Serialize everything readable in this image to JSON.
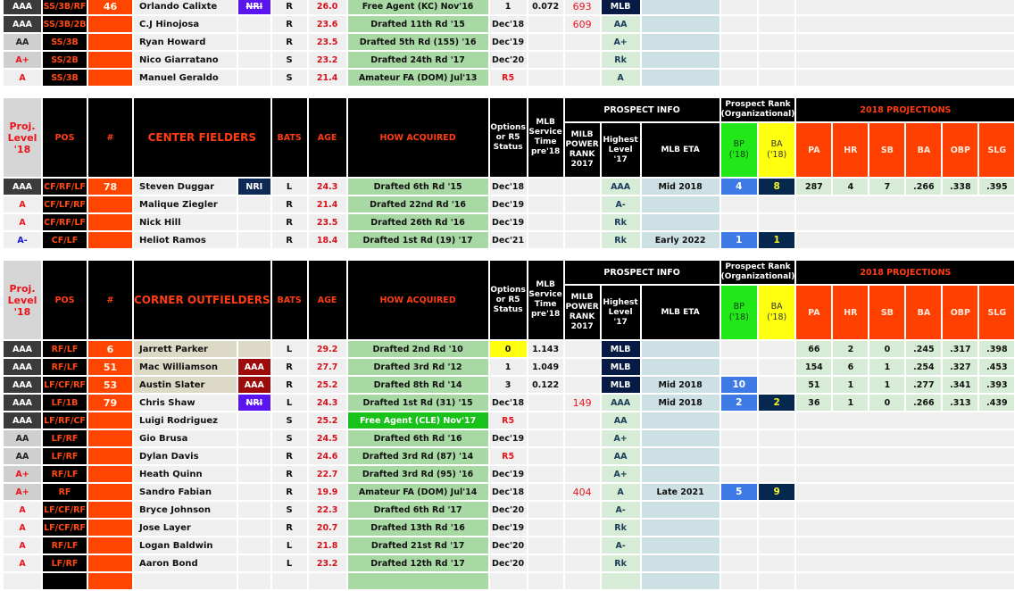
{
  "headers": {
    "proj_level": "Proj. Level '18",
    "pos": "POS",
    "num": "#",
    "bats": "BATS",
    "age": "AGE",
    "how_acquired": "HOW ACQUIRED",
    "options": "Options or R5 Status",
    "service_time": "MLB Service Time pre'18",
    "prospect_info": "PROSPECT INFO",
    "power_rank": "MILB POWER RANK 2017",
    "highest_level": "Highest Level '17",
    "mlb_eta": "MLB ETA",
    "prospect_rank": "Prospect Rank (Organizational)",
    "bp": "BP ('18)",
    "ba": "BA ('18)",
    "projections": "2018 PROJECTIONS",
    "proj_cols": [
      "PA",
      "HR",
      "SB",
      "BA",
      "OBP",
      "SLG"
    ]
  },
  "sections": [
    {
      "title": "",
      "rows": [
        {
          "level": "AAA",
          "level_style": "dark",
          "pos": "SS/3B/RF",
          "num": "46",
          "name": "Orlando Calixte",
          "badge": "NRI",
          "badge_style": "nri-purple",
          "bats": "R",
          "age": "26.0",
          "how": "Free Agent (KC) Nov'16",
          "how_style": "",
          "opt": "1",
          "opt_style": "",
          "svc": "0.072",
          "pwr": "693",
          "hi": "MLB",
          "eta": "",
          "bp": "",
          "ba": "",
          "proj": null
        },
        {
          "level": "AAA",
          "level_style": "dark",
          "pos": "SS/3B/2B",
          "num": "",
          "name": "C.J Hinojosa",
          "badge": "",
          "badge_style": "",
          "bats": "R",
          "age": "23.6",
          "how": "Drafted 11th Rd '15",
          "how_style": "",
          "opt": "Dec'18",
          "opt_style": "",
          "svc": "",
          "pwr": "609",
          "hi": "AA",
          "eta": "",
          "bp": "",
          "ba": "",
          "proj": null
        },
        {
          "level": "AA",
          "level_style": "light",
          "pos": "SS/3B",
          "num": "",
          "name": "Ryan Howard",
          "badge": "",
          "badge_style": "",
          "bats": "R",
          "age": "23.5",
          "how": "Drafted 5th Rd (155) '16",
          "how_style": "",
          "opt": "Dec'19",
          "opt_style": "",
          "svc": "",
          "pwr": "",
          "hi": "A+",
          "eta": "",
          "bp": "",
          "ba": "",
          "proj": null
        },
        {
          "level": "A+",
          "level_style": "red-light",
          "pos": "SS/2B",
          "num": "",
          "name": "Nico Giarratano",
          "badge": "",
          "badge_style": "",
          "bats": "S",
          "age": "23.2",
          "how": "Drafted 24th Rd '17",
          "how_style": "",
          "opt": "Dec'20",
          "opt_style": "",
          "svc": "",
          "pwr": "",
          "hi": "Rk",
          "eta": "",
          "bp": "",
          "ba": "",
          "proj": null
        },
        {
          "level": "A",
          "level_style": "pale",
          "pos": "SS/3B",
          "num": "",
          "name": "Manuel Geraldo",
          "badge": "",
          "badge_style": "",
          "bats": "S",
          "age": "21.4",
          "how": "Amateur FA (DOM) Jul'13",
          "how_style": "",
          "opt": "R5",
          "opt_style": "r5",
          "svc": "",
          "pwr": "",
          "hi": "A",
          "eta": "",
          "bp": "",
          "ba": "",
          "proj": null
        }
      ]
    },
    {
      "title": "CENTER FIELDERS",
      "rows": [
        {
          "level": "AAA",
          "level_style": "dark",
          "pos": "CF/RF/LF",
          "num": "78",
          "name": "Steven Duggar",
          "badge": "NRI",
          "badge_style": "nri-navy",
          "bats": "L",
          "age": "24.3",
          "how": "Drafted 6th Rd '15",
          "how_style": "",
          "opt": "Dec'18",
          "opt_style": "",
          "svc": "",
          "pwr": "",
          "hi": "AAA",
          "eta": "Mid 2018",
          "bp": "4",
          "ba": "8",
          "proj": [
            "287",
            "4",
            "7",
            ".266",
            ".338",
            ".395"
          ]
        },
        {
          "level": "A",
          "level_style": "pale",
          "pos": "CF/LF/RF",
          "num": "",
          "name": "Malique Ziegler",
          "badge": "",
          "badge_style": "",
          "bats": "R",
          "age": "21.4",
          "how": "Drafted 22nd Rd '16",
          "how_style": "",
          "opt": "Dec'19",
          "opt_style": "",
          "svc": "",
          "pwr": "",
          "hi": "A-",
          "eta": "",
          "bp": "",
          "ba": "",
          "proj": null
        },
        {
          "level": "A",
          "level_style": "pale",
          "pos": "CF/RF/LF",
          "num": "",
          "name": "Nick Hill",
          "badge": "",
          "badge_style": "",
          "bats": "R",
          "age": "23.5",
          "how": "Drafted 26th Rd '16",
          "how_style": "",
          "opt": "Dec'19",
          "opt_style": "",
          "svc": "",
          "pwr": "",
          "hi": "Rk",
          "eta": "",
          "bp": "",
          "ba": "",
          "proj": null
        },
        {
          "level": "A-",
          "level_style": "blue",
          "pos": "CF/LF",
          "num": "",
          "name": "Heliot Ramos",
          "badge": "",
          "badge_style": "",
          "bats": "R",
          "age": "18.4",
          "how": "Drafted 1st Rd (19) '17",
          "how_style": "",
          "opt": "Dec'21",
          "opt_style": "",
          "svc": "",
          "pwr": "",
          "hi": "Rk",
          "eta": "Early 2022",
          "bp": "1",
          "ba": "1",
          "proj": null
        }
      ]
    },
    {
      "title": "CORNER OUTFIELDERS",
      "rows": [
        {
          "level": "AAA",
          "level_style": "dark",
          "pos": "RF/LF",
          "num": "6",
          "name": "Jarrett Parker",
          "name_style": "tan",
          "badge": "",
          "badge_style": "tan",
          "bats": "L",
          "age": "29.2",
          "how": "Drafted 2nd Rd '10",
          "how_style": "",
          "opt": "0",
          "opt_style": "yellow",
          "svc": "1.143",
          "pwr": "",
          "hi": "MLB",
          "eta": "",
          "bp": "",
          "ba": "",
          "proj": [
            "66",
            "2",
            "0",
            ".245",
            ".317",
            ".398"
          ]
        },
        {
          "level": "AAA",
          "level_style": "dark",
          "pos": "RF/LF",
          "num": "51",
          "name": "Mac Williamson",
          "name_style": "tan",
          "badge": "AAA",
          "badge_style": "aaa-red",
          "bats": "R",
          "age": "27.7",
          "how": "Drafted 3rd Rd '12",
          "how_style": "",
          "opt": "1",
          "opt_style": "",
          "svc": "1.049",
          "pwr": "",
          "hi": "MLB",
          "eta": "",
          "bp": "",
          "ba": "",
          "proj": [
            "154",
            "6",
            "1",
            ".254",
            ".327",
            ".453"
          ]
        },
        {
          "level": "AAA",
          "level_style": "dark",
          "pos": "LF/CF/RF",
          "num": "53",
          "name": "Austin Slater",
          "name_style": "tan",
          "badge": "AAA",
          "badge_style": "aaa-red",
          "bats": "R",
          "age": "25.2",
          "how": "Drafted 8th Rd '14",
          "how_style": "",
          "opt": "3",
          "opt_style": "",
          "svc": "0.122",
          "pwr": "",
          "hi": "MLB",
          "eta": "Mid 2018",
          "bp": "10",
          "ba": "",
          "proj": [
            "51",
            "1",
            "1",
            ".277",
            ".341",
            ".393"
          ]
        },
        {
          "level": "AAA",
          "level_style": "dark",
          "pos": "LF/1B",
          "num": "79",
          "name": "Chris Shaw",
          "badge": "NRI",
          "badge_style": "nri-purple",
          "bats": "L",
          "age": "24.3",
          "how": "Drafted 1st Rd (31) '15",
          "how_style": "",
          "opt": "Dec'18",
          "opt_style": "",
          "svc": "",
          "pwr": "149",
          "hi": "AAA",
          "eta": "Mid 2018",
          "bp": "2",
          "ba": "2",
          "proj": [
            "36",
            "1",
            "0",
            ".266",
            ".313",
            ".439"
          ]
        },
        {
          "level": "AAA",
          "level_style": "dark",
          "pos": "LF/RF/CF",
          "num": "",
          "name": "Luigi Rodriguez",
          "badge": "",
          "badge_style": "",
          "bats": "S",
          "age": "25.2",
          "how": "Free Agent (CLE) Nov'17",
          "how_style": "fa-green",
          "opt": "R5",
          "opt_style": "r5",
          "svc": "",
          "pwr": "",
          "hi": "AA",
          "eta": "",
          "bp": "",
          "ba": "",
          "proj": null
        },
        {
          "level": "AA",
          "level_style": "light",
          "pos": "LF/RF",
          "num": "",
          "name": "Gio Brusa",
          "badge": "",
          "badge_style": "",
          "bats": "S",
          "age": "24.5",
          "how": "Drafted 6th Rd '16",
          "how_style": "",
          "opt": "Dec'19",
          "opt_style": "",
          "svc": "",
          "pwr": "",
          "hi": "A+",
          "eta": "",
          "bp": "",
          "ba": "",
          "proj": null
        },
        {
          "level": "AA",
          "level_style": "light",
          "pos": "LF/RF",
          "num": "",
          "name": "Dylan Davis",
          "badge": "",
          "badge_style": "",
          "bats": "R",
          "age": "24.6",
          "how": "Drafted 3rd Rd (87) '14",
          "how_style": "",
          "opt": "R5",
          "opt_style": "r5",
          "svc": "",
          "pwr": "",
          "hi": "AA",
          "eta": "",
          "bp": "",
          "ba": "",
          "proj": null
        },
        {
          "level": "A+",
          "level_style": "red-light",
          "pos": "RF/LF",
          "num": "",
          "name": "Heath Quinn",
          "badge": "",
          "badge_style": "",
          "bats": "R",
          "age": "22.7",
          "how": "Drafted 3rd Rd (95) '16",
          "how_style": "",
          "opt": "Dec'19",
          "opt_style": "",
          "svc": "",
          "pwr": "",
          "hi": "A+",
          "eta": "",
          "bp": "",
          "ba": "",
          "proj": null
        },
        {
          "level": "A+",
          "level_style": "red-light",
          "pos": "RF",
          "num": "",
          "name": "Sandro Fabian",
          "badge": "",
          "badge_style": "",
          "bats": "R",
          "age": "19.9",
          "how": "Amateur FA (DOM) Jul'14",
          "how_style": "",
          "opt": "Dec'18",
          "opt_style": "",
          "svc": "",
          "pwr": "404",
          "hi": "A",
          "eta": "Late 2021",
          "bp": "5",
          "ba": "9",
          "proj": null
        },
        {
          "level": "A",
          "level_style": "pale",
          "pos": "LF/CF/RF",
          "num": "",
          "name": "Bryce Johnson",
          "badge": "",
          "badge_style": "",
          "bats": "S",
          "age": "22.3",
          "how": "Drafted 6th Rd '17",
          "how_style": "",
          "opt": "Dec'20",
          "opt_style": "",
          "svc": "",
          "pwr": "",
          "hi": "A-",
          "eta": "",
          "bp": "",
          "ba": "",
          "proj": null
        },
        {
          "level": "A",
          "level_style": "pale",
          "pos": "LF/CF/RF",
          "num": "",
          "name": "Jose Layer",
          "badge": "",
          "badge_style": "",
          "bats": "R",
          "age": "20.7",
          "how": "Drafted 13th Rd '16",
          "how_style": "",
          "opt": "Dec'19",
          "opt_style": "",
          "svc": "",
          "pwr": "",
          "hi": "Rk",
          "eta": "",
          "bp": "",
          "ba": "",
          "proj": null
        },
        {
          "level": "A",
          "level_style": "pale",
          "pos": "RF/LF",
          "num": "",
          "name": "Logan Baldwin",
          "badge": "",
          "badge_style": "",
          "bats": "L",
          "age": "21.8",
          "how": "Drafted 21st Rd '17",
          "how_style": "",
          "opt": "Dec'20",
          "opt_style": "",
          "svc": "",
          "pwr": "",
          "hi": "A-",
          "eta": "",
          "bp": "",
          "ba": "",
          "proj": null
        },
        {
          "level": "A",
          "level_style": "pale",
          "pos": "LF/RF",
          "num": "",
          "name": "Aaron Bond",
          "badge": "",
          "badge_style": "",
          "bats": "L",
          "age": "23.2",
          "how": "Drafted 12th Rd '17",
          "how_style": "",
          "opt": "Dec'20",
          "opt_style": "",
          "svc": "",
          "pwr": "",
          "hi": "Rk",
          "eta": "",
          "bp": "",
          "ba": "",
          "proj": null
        },
        {
          "level": "",
          "level_style": "pale",
          "pos": "",
          "num": "",
          "name": "",
          "badge": "",
          "badge_style": "",
          "bats": "",
          "age": "",
          "how": "",
          "how_style": "",
          "opt": "",
          "opt_style": "",
          "svc": "",
          "pwr": "",
          "hi": "",
          "eta": "",
          "bp": "",
          "ba": "",
          "proj": null
        }
      ]
    }
  ]
}
